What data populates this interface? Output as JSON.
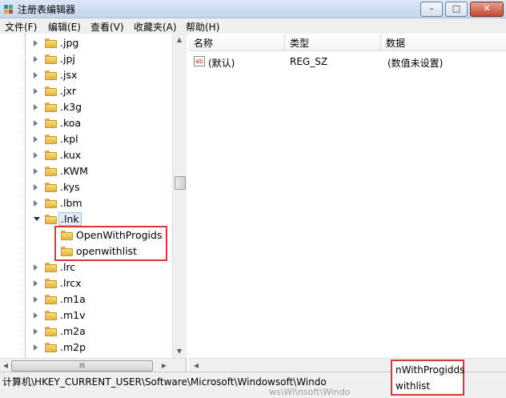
{
  "window": {
    "title": "注册表编辑器",
    "controls": {
      "minimize": "–",
      "maximize": "□",
      "close": "✕"
    }
  },
  "menu": [
    "文件(F)",
    "编辑(E)",
    "查看(V)",
    "收藏夹(A)",
    "帮助(H)"
  ],
  "tree": {
    "items": [
      ".jpg",
      ".jpj",
      ".jsx",
      ".jxr",
      ".k3g",
      ".koa",
      ".kpl",
      ".kux",
      ".KWM",
      ".kys",
      ".lbm",
      ".lnk",
      ".lrc",
      ".lrcx",
      ".m1a",
      ".m1v",
      ".m2a",
      ".m2p"
    ],
    "expanded_item": ".lnk",
    "children": [
      "OpenWithProgids",
      "openwithlist"
    ]
  },
  "list": {
    "headers": {
      "name": "名称",
      "type": "类型",
      "data": "数据"
    },
    "rows": [
      {
        "icon": "ab",
        "name": "(默认)",
        "type": "REG_SZ",
        "data": "(数值未设置)"
      }
    ]
  },
  "status": {
    "path": "计算机\\HKEY_CURRENT_USER\\Software\\Microsoft\\Windowsoft\\Windo",
    "ghost": "ws\\Wi\\nsoft\\Windo"
  },
  "popup": {
    "line1": "nWithProgidds",
    "line2": "withlist"
  },
  "scroll": {
    "hthumb_grip": "III",
    "up": "▲",
    "down": "▼",
    "left": "◀",
    "right": "▶"
  },
  "colors": {
    "highlight_border": "#d9373b",
    "selection_bg": "#e4eef9",
    "folder": "#f9dc72"
  }
}
